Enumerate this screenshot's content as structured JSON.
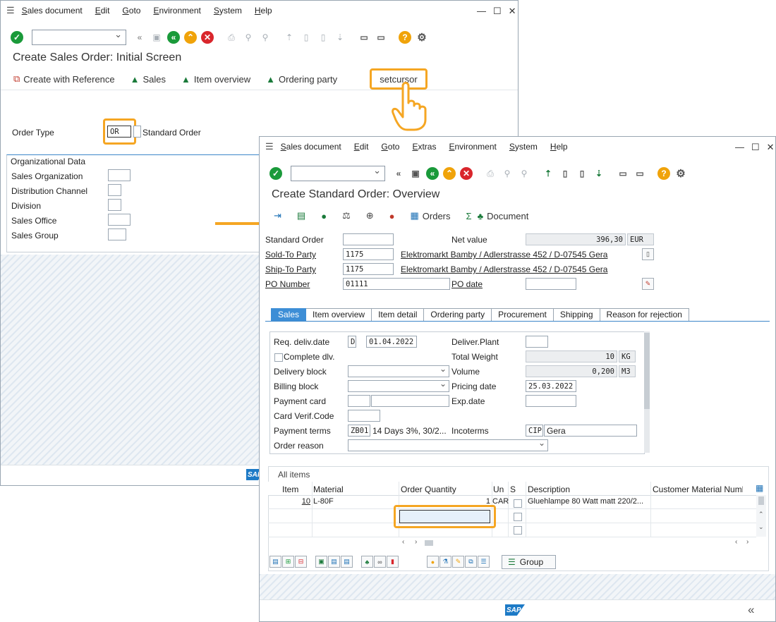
{
  "window1": {
    "menu": [
      "Sales document",
      "Edit",
      "Goto",
      "Environment",
      "System",
      "Help"
    ],
    "title": "Create Sales Order: Initial Screen",
    "app_buttons": {
      "create_ref": "Create with Reference",
      "sales": "Sales",
      "item_overview": "Item overview",
      "ordering_party": "Ordering party",
      "setcursor": "setcursor"
    },
    "order_type_label": "Order Type",
    "order_type_value": "OR",
    "order_type_text": "Standard Order",
    "org_title": "Organizational Data",
    "org_fields": [
      "Sales Organization",
      "Distribution Channel",
      "Division",
      "Sales Office",
      "Sales Group"
    ]
  },
  "window2": {
    "menu": [
      "Sales document",
      "Edit",
      "Goto",
      "Extras",
      "Environment",
      "System",
      "Help"
    ],
    "title": "Create Standard Order: Overview",
    "appbar": {
      "orders": "Orders",
      "document": "Document"
    },
    "header": {
      "standard_order_label": "Standard Order",
      "net_value_label": "Net value",
      "net_value": "396,30",
      "currency": "EUR",
      "sold_to_label": "Sold-To Party",
      "sold_to_value": "1175",
      "sold_to_text": "Elektromarkt Bamby / Adlerstrasse 452 / D-07545 Gera",
      "ship_to_label": "Ship-To Party",
      "ship_to_value": "1175",
      "ship_to_text": "Elektromarkt Bamby / Adlerstrasse 452 / D-07545 Gera",
      "po_number_label": "PO Number",
      "po_number_value": "01111",
      "po_date_label": "PO date"
    },
    "tabs": [
      "Sales",
      "Item overview",
      "Item detail",
      "Ordering party",
      "Procurement",
      "Shipping",
      "Reason for rejection"
    ],
    "sales_tab": {
      "req_deliv_label": "Req. deliv.date",
      "req_deliv_format": "D",
      "req_deliv_value": "01.04.2022",
      "deliver_plant_label": "Deliver.Plant",
      "complete_dlv_label": "Complete dlv.",
      "total_weight_label": "Total Weight",
      "total_weight_value": "10",
      "total_weight_unit": "KG",
      "delivery_block_label": "Delivery block",
      "volume_label": "Volume",
      "volume_value": "0,200",
      "volume_unit": "M3",
      "billing_block_label": "Billing block",
      "pricing_date_label": "Pricing date",
      "pricing_date_value": "25.03.2022",
      "payment_card_label": "Payment card",
      "exp_date_label": "Exp.date",
      "card_verif_label": "Card Verif.Code",
      "payment_terms_label": "Payment terms",
      "payment_terms_code": "ZB01",
      "payment_terms_text": "14 Days 3%, 30/2...",
      "incoterms_label": "Incoterms",
      "incoterms_code": "CIP",
      "incoterms_place": "Gera",
      "order_reason_label": "Order reason"
    },
    "items": {
      "title": "All items",
      "columns": [
        "Item",
        "Material",
        "Order Quantity",
        "Un",
        "S",
        "Description",
        "Customer Material Numb"
      ],
      "rows": [
        {
          "item": "10",
          "material": "L-80F",
          "qty": "1",
          "unit": "CAR",
          "desc": "Gluehlampe 80 Watt matt 220/2..."
        }
      ],
      "group_button": "Group"
    }
  }
}
